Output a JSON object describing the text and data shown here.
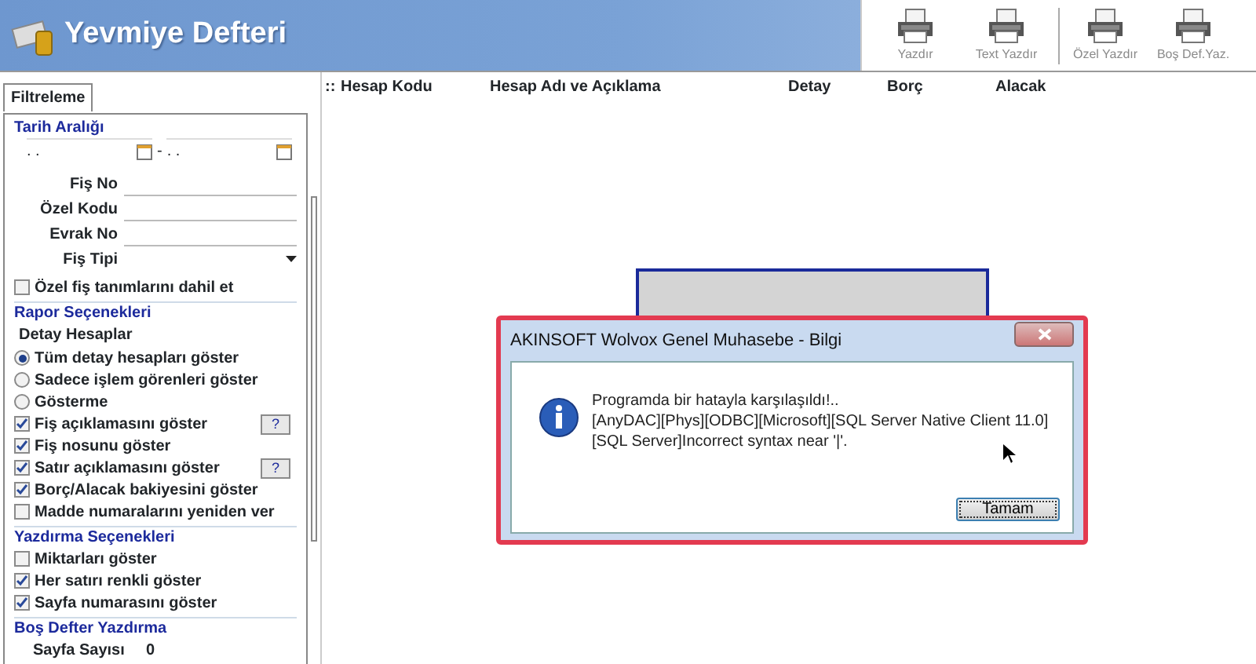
{
  "header": {
    "title": "Yevmiye Defteri"
  },
  "toolbar": [
    {
      "label": "Yazdır",
      "separator_before": false
    },
    {
      "label": "Text Yazdır",
      "separator_before": false
    },
    {
      "label": "Özel Yazdır",
      "separator_before": true
    },
    {
      "label": "Boş Def.Yaz.",
      "separator_before": false
    }
  ],
  "tabs": [
    {
      "label": "Filtreleme",
      "selected": true
    }
  ],
  "date_range": {
    "title": "Tarih Aralığı",
    "from": ". .",
    "separator": "-",
    "to": ". ."
  },
  "fields": [
    {
      "label": "Fiş No",
      "kind": "text"
    },
    {
      "label": "Özel Kodu",
      "kind": "text"
    },
    {
      "label": "Evrak No",
      "kind": "text"
    },
    {
      "label": "Fiş Tipi",
      "kind": "dropdown"
    }
  ],
  "options": [
    {
      "kind": "checkbox",
      "label": "Özel fiş tanımlarını dahil et",
      "checked": false
    },
    {
      "kind": "section",
      "label": "Rapor Seçenekleri"
    },
    {
      "kind": "subheading",
      "label": "Detay Hesaplar"
    },
    {
      "kind": "radio",
      "label": "Tüm detay hesapları göster",
      "selected": true
    },
    {
      "kind": "radio",
      "label": "Sadece işlem görenleri göster",
      "selected": false
    },
    {
      "kind": "radio",
      "label": "Gösterme",
      "selected": false
    },
    {
      "kind": "checkbox",
      "label": "Fiş açıklamasını göster",
      "checked": true,
      "help": "?"
    },
    {
      "kind": "checkbox",
      "label": "Fiş nosunu göster",
      "checked": true
    },
    {
      "kind": "checkbox",
      "label": "Satır açıklamasını göster",
      "checked": true,
      "help": "?"
    },
    {
      "kind": "checkbox",
      "label": "Borç/Alacak bakiyesini göster",
      "checked": true
    },
    {
      "kind": "checkbox",
      "label": "Madde numaralarını yeniden ver",
      "checked": false
    },
    {
      "kind": "section",
      "label": "Yazdırma Seçenekleri"
    },
    {
      "kind": "checkbox",
      "label": "Miktarları göster",
      "checked": false
    },
    {
      "kind": "checkbox",
      "label": "Her satırı renkli göster",
      "checked": true
    },
    {
      "kind": "checkbox",
      "label": "Sayfa numarasını göster",
      "checked": true
    },
    {
      "kind": "section",
      "label": "Boş Defter Yazdırma"
    },
    {
      "kind": "number",
      "label": "Sayfa Sayısı",
      "value": "0"
    }
  ],
  "grid": {
    "columns": [
      "::",
      "Hesap Kodu",
      "Hesap Adı ve Açıklama",
      "Detay",
      "Borç",
      "Alacak"
    ]
  },
  "dialog": {
    "title": "AKINSOFT Wolvox Genel Muhasebe - Bilgi",
    "message": "Programda bir hatayla karşılaşıldı!..",
    "detail": "[AnyDAC][Phys][ODBC][Microsoft][SQL Server Native Client 11.0][SQL Server]Incorrect syntax near '|'.",
    "button": "Tamam"
  }
}
